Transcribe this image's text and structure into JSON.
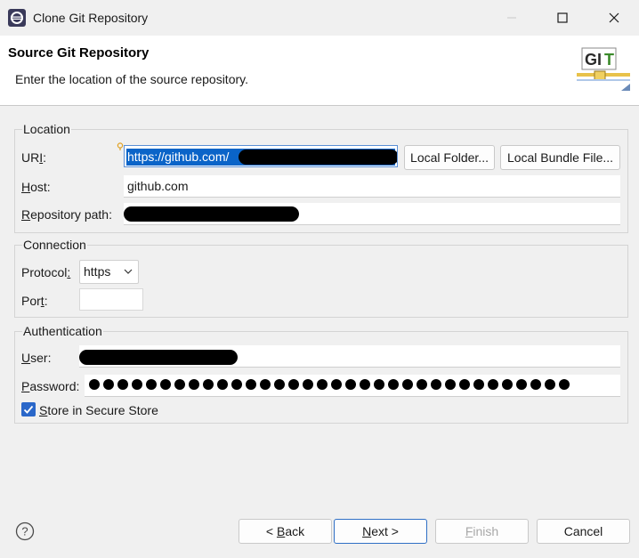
{
  "window": {
    "title": "Clone Git Repository"
  },
  "banner": {
    "title": "Source Git Repository",
    "subtitle": "Enter the location of the source repository.",
    "logo_text": "GIT"
  },
  "location": {
    "group_title": "Location",
    "uri_label": "URI:",
    "uri_value": "https://github.com/",
    "local_folder_button": "Local Folder...",
    "local_bundle_button": "Local Bundle File...",
    "host_label": "Host:",
    "host_value": "github.com",
    "repo_path_label": "Repository path:",
    "repo_path_value": ""
  },
  "connection": {
    "group_title": "Connection",
    "protocol_label": "Protocol:",
    "protocol_value": "https",
    "port_label": "Port:",
    "port_value": ""
  },
  "authentication": {
    "group_title": "Authentication",
    "user_label": "User:",
    "user_value": "",
    "password_label": "Password:",
    "password_mask_count": 34,
    "store_label": "Store in Secure Store",
    "store_checked": true
  },
  "footer": {
    "back_button": "< Back",
    "next_button": "Next >",
    "finish_button": "Finish",
    "cancel_button": "Cancel"
  },
  "icons": {
    "app": "eclipse-icon",
    "help": "help-icon",
    "minimize": "minimize-icon",
    "maximize": "maximize-icon",
    "close": "close-icon",
    "content_assist": "lightbulb-icon",
    "dropdown": "chevron-down-icon",
    "check": "checkmark-icon"
  },
  "colors": {
    "accent": "#2a67c9",
    "selection": "#0a64c8",
    "window_bg": "#f0f0f0"
  }
}
